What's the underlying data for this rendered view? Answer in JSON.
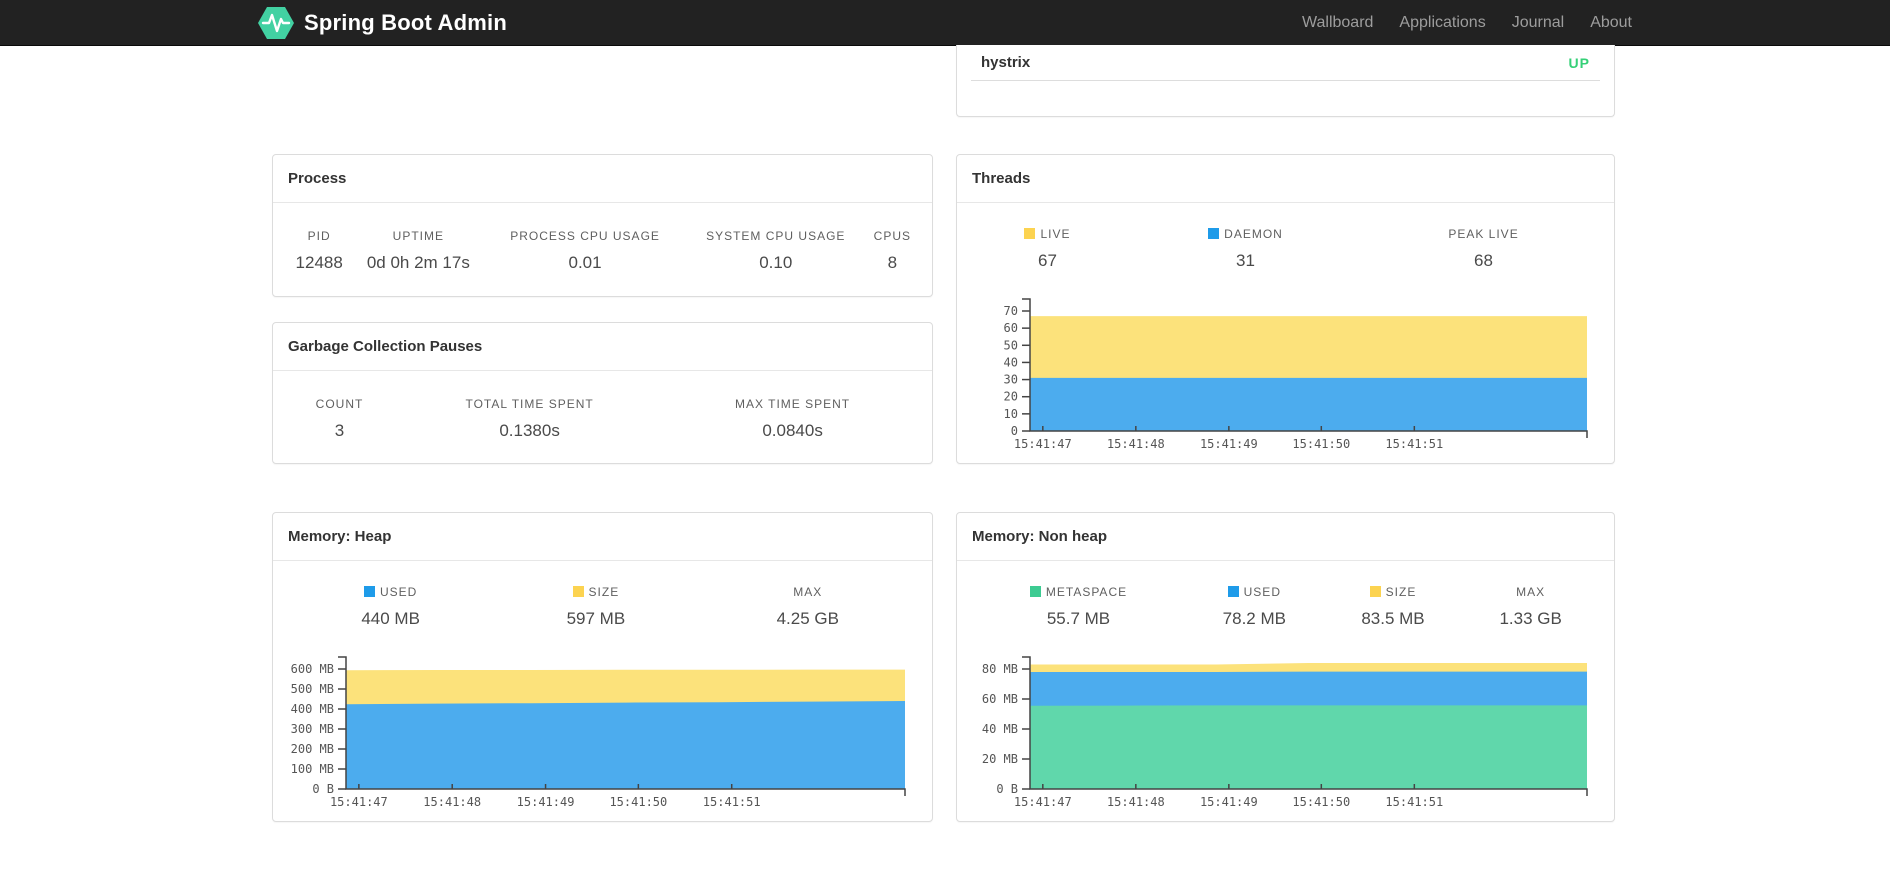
{
  "navbar": {
    "brand": "Spring Boot Admin",
    "items": [
      {
        "id": "wallboard",
        "label": "Wallboard"
      },
      {
        "id": "applications",
        "label": "Applications"
      },
      {
        "id": "journal",
        "label": "Journal"
      },
      {
        "id": "about",
        "label": "About"
      }
    ]
  },
  "status_panel": {
    "application": "hystrix",
    "status": "UP",
    "status_color": "#35d077"
  },
  "colors": {
    "brand_green": "#42d1a2",
    "legend_yellow": "#fcd350",
    "legend_blue": "#1e9be9",
    "legend_green": "#3dcb92",
    "area_yellow": "#fce27b",
    "area_blue": "#4cacee",
    "area_green": "#60d7ab"
  },
  "panels": {
    "process": {
      "title": "Process",
      "metrics": [
        {
          "label": "PID",
          "value": "12488"
        },
        {
          "label": "UPTIME",
          "value": "0d 0h 2m 17s"
        },
        {
          "label": "PROCESS CPU USAGE",
          "value": "0.01"
        },
        {
          "label": "SYSTEM CPU USAGE",
          "value": "0.10"
        },
        {
          "label": "CPUS",
          "value": "8"
        }
      ]
    },
    "gc": {
      "title": "Garbage Collection Pauses",
      "metrics": [
        {
          "label": "COUNT",
          "value": "3"
        },
        {
          "label": "TOTAL TIME SPENT",
          "value": "0.1380s"
        },
        {
          "label": "MAX TIME SPENT",
          "value": "0.0840s"
        }
      ]
    },
    "threads": {
      "title": "Threads",
      "metrics": [
        {
          "label": "LIVE",
          "value": "67",
          "color": "#fcd350"
        },
        {
          "label": "DAEMON",
          "value": "31",
          "color": "#1e9be9"
        },
        {
          "label": "PEAK LIVE",
          "value": "68"
        }
      ]
    },
    "heap": {
      "title": "Memory: Heap",
      "metrics": [
        {
          "label": "USED",
          "value": "440 MB",
          "color": "#1e9be9"
        },
        {
          "label": "SIZE",
          "value": "597 MB",
          "color": "#fcd350"
        },
        {
          "label": "MAX",
          "value": "4.25 GB"
        }
      ]
    },
    "nonheap": {
      "title": "Memory: Non heap",
      "metrics": [
        {
          "label": "METASPACE",
          "value": "55.7 MB",
          "color": "#3dcb92"
        },
        {
          "label": "USED",
          "value": "78.2 MB",
          "color": "#1e9be9"
        },
        {
          "label": "SIZE",
          "value": "83.5 MB",
          "color": "#fcd350"
        },
        {
          "label": "MAX",
          "value": "1.33 GB"
        }
      ]
    }
  },
  "chart_data": [
    {
      "id": "chart-threads",
      "type": "area",
      "title": "Threads",
      "stacked": true,
      "grid": false,
      "legend_position": "top",
      "x_labels": [
        "15:41:47",
        "15:41:48",
        "15:41:49",
        "15:41:50",
        "15:41:51"
      ],
      "x_fracs": [
        0.023,
        0.19,
        0.357,
        0.523,
        0.69
      ],
      "ylim": [
        0,
        70
      ],
      "y_ticks": [
        {
          "v": 0,
          "label": "0"
        },
        {
          "v": 10,
          "label": "10"
        },
        {
          "v": 20,
          "label": "20"
        },
        {
          "v": 30,
          "label": "30"
        },
        {
          "v": 40,
          "label": "40"
        },
        {
          "v": 50,
          "label": "50"
        },
        {
          "v": 60,
          "label": "60"
        },
        {
          "v": 70,
          "label": "70"
        }
      ],
      "series": [
        {
          "name": "LIVE",
          "color": "#fce27b",
          "values": [
            67,
            67,
            67,
            67,
            67,
            67,
            67
          ]
        },
        {
          "name": "DAEMON",
          "color": "#4cacee",
          "values": [
            31,
            31,
            31,
            31,
            31,
            31,
            31
          ]
        }
      ]
    },
    {
      "id": "chart-heap",
      "type": "area",
      "title": "Memory: Heap",
      "stacked": true,
      "grid": false,
      "legend_position": "top",
      "x_labels": [
        "15:41:47",
        "15:41:48",
        "15:41:49",
        "15:41:50",
        "15:41:51"
      ],
      "x_fracs": [
        0.023,
        0.19,
        0.357,
        0.523,
        0.69
      ],
      "ylim": [
        0,
        600
      ],
      "y_unit": "MB",
      "y_ticks": [
        {
          "v": 0,
          "label": "0 B"
        },
        {
          "v": 100,
          "label": "100 MB"
        },
        {
          "v": 200,
          "label": "200 MB"
        },
        {
          "v": 300,
          "label": "300 MB"
        },
        {
          "v": 400,
          "label": "400 MB"
        },
        {
          "v": 500,
          "label": "500 MB"
        },
        {
          "v": 600,
          "label": "600 MB"
        }
      ],
      "series": [
        {
          "name": "SIZE",
          "color": "#fce27b",
          "values": [
            594,
            595,
            595,
            596,
            596,
            597,
            597
          ]
        },
        {
          "name": "USED",
          "color": "#4cacee",
          "values": [
            424,
            427,
            429,
            432,
            434,
            437,
            440
          ]
        }
      ]
    },
    {
      "id": "chart-nonheap",
      "type": "area",
      "title": "Memory: Non heap",
      "stacked": true,
      "grid": false,
      "legend_position": "top",
      "x_labels": [
        "15:41:47",
        "15:41:48",
        "15:41:49",
        "15:41:50",
        "15:41:51"
      ],
      "x_fracs": [
        0.023,
        0.19,
        0.357,
        0.523,
        0.69
      ],
      "ylim": [
        0,
        80
      ],
      "y_unit": "MB",
      "y_ticks": [
        {
          "v": 0,
          "label": "0 B"
        },
        {
          "v": 20,
          "label": "20 MB"
        },
        {
          "v": 40,
          "label": "40 MB"
        },
        {
          "v": 60,
          "label": "60 MB"
        },
        {
          "v": 80,
          "label": "80 MB"
        }
      ],
      "series": [
        {
          "name": "SIZE",
          "color": "#fce27b",
          "values": [
            83,
            83,
            83,
            84,
            84,
            84,
            84
          ]
        },
        {
          "name": "USED",
          "color": "#4cacee",
          "values": [
            78,
            78,
            78,
            78.3,
            78.3,
            78.3,
            78.3
          ]
        },
        {
          "name": "METASPACE",
          "color": "#60d7ab",
          "values": [
            55.5,
            55.6,
            55.7,
            55.7,
            55.7,
            55.7,
            55.7
          ]
        }
      ]
    }
  ]
}
